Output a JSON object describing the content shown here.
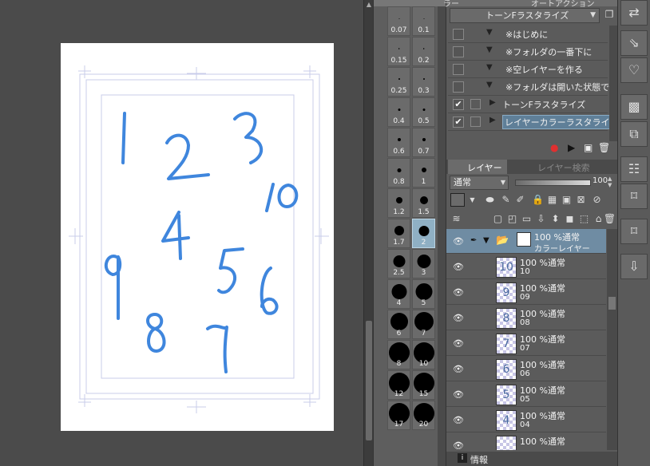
{
  "canvas": {
    "handwritten_numbers": [
      "1",
      "2",
      "3",
      "10",
      "4",
      "9",
      "5",
      "6",
      "8",
      "7"
    ]
  },
  "brush_palette": {
    "sizes": [
      "0.07",
      "0.1",
      "0.15",
      "0.2",
      "0.25",
      "0.3",
      "0.4",
      "0.5",
      "0.6",
      "0.7",
      "0.8",
      "1",
      "1.2",
      "1.5",
      "1.7",
      "2",
      "2.5",
      "3",
      "4",
      "5",
      "6",
      "7",
      "8",
      "10",
      "12",
      "15",
      "17",
      "20"
    ],
    "selected_size": "2"
  },
  "auto_action": {
    "tab_label_1": "ラー",
    "tab_label_2": "オートアクション",
    "set_name": "トーンFラスタライズ",
    "items": [
      {
        "label": "※はじめに",
        "checked": false,
        "highlighted": false,
        "expanded": true
      },
      {
        "label": "※フォルダの一番下に",
        "checked": false,
        "highlighted": false,
        "expanded": true
      },
      {
        "label": "※空レイヤーを作る",
        "checked": false,
        "highlighted": false,
        "expanded": true
      },
      {
        "label": "※フォルダは開いた状態で",
        "checked": false,
        "highlighted": false,
        "expanded": true
      },
      {
        "label": "トーンFラスタライズ",
        "checked": true,
        "highlighted": false,
        "expanded": false
      },
      {
        "label": "レイヤーカラーラスタライズ",
        "checked": true,
        "highlighted": true,
        "expanded": false
      }
    ]
  },
  "layer_panel": {
    "tab_layers": "レイヤー",
    "tab_search": "レイヤー検索",
    "blend_mode": "通常",
    "opacity": "100",
    "folder": {
      "blend": "100 %通常",
      "name": "カラーレイヤー"
    },
    "layers": [
      {
        "blend": "100 %通常",
        "name": "10",
        "thumb": "10"
      },
      {
        "blend": "100 %通常",
        "name": "09",
        "thumb": "9"
      },
      {
        "blend": "100 %通常",
        "name": "08",
        "thumb": "8"
      },
      {
        "blend": "100 %通常",
        "name": "07",
        "thumb": "7"
      },
      {
        "blend": "100 %通常",
        "name": "06",
        "thumb": "6"
      },
      {
        "blend": "100 %通常",
        "name": "05",
        "thumb": "5"
      },
      {
        "blend": "100 %通常",
        "name": "04",
        "thumb": "4"
      },
      {
        "blend": "100 %通常",
        "name": "",
        "thumb": ""
      }
    ]
  },
  "info_tab": {
    "label": "情報"
  }
}
